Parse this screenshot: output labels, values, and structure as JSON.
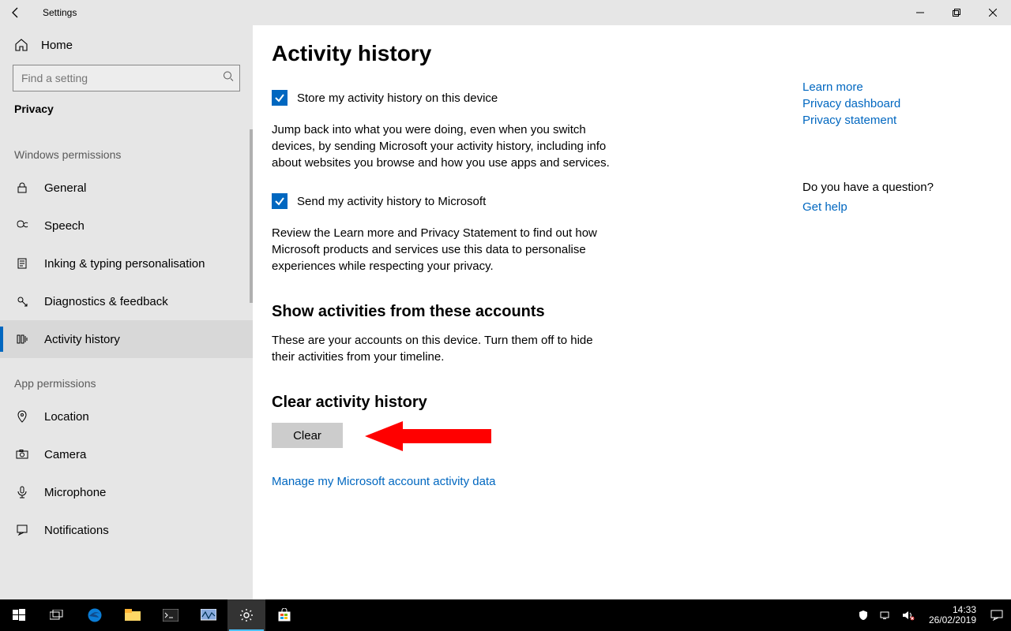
{
  "titlebar": {
    "title": "Settings"
  },
  "sidebar": {
    "home_label": "Home",
    "search_placeholder": "Find a setting",
    "category": "Privacy",
    "group1_title": "Windows permissions",
    "group1_items": [
      {
        "label": "General"
      },
      {
        "label": "Speech"
      },
      {
        "label": "Inking & typing personalisation"
      },
      {
        "label": "Diagnostics & feedback"
      },
      {
        "label": "Activity history"
      }
    ],
    "group2_title": "App permissions",
    "group2_items": [
      {
        "label": "Location"
      },
      {
        "label": "Camera"
      },
      {
        "label": "Microphone"
      },
      {
        "label": "Notifications"
      }
    ]
  },
  "main": {
    "heading": "Activity history",
    "checkbox1_label": "Store my activity history on this device",
    "description1": "Jump back into what you were doing, even when you switch devices, by sending Microsoft your activity history, including info about websites you browse and how you use apps and services.",
    "checkbox2_label": "Send my activity history to Microsoft",
    "description2": "Review the Learn more and Privacy Statement to find out how Microsoft products and services use this data to personalise experiences while respecting your privacy.",
    "sub1_heading": "Show activities from these accounts",
    "sub1_text": "These are your accounts on this device. Turn them off to hide their activities from your timeline.",
    "sub2_heading": "Clear activity history",
    "clear_button": "Clear",
    "manage_link": "Manage my Microsoft account activity data"
  },
  "aside": {
    "link1": "Learn more",
    "link2": "Privacy dashboard",
    "link3": "Privacy statement",
    "question": "Do you have a question?",
    "help_link": "Get help"
  },
  "taskbar": {
    "time": "14:33",
    "date": "26/02/2019"
  }
}
